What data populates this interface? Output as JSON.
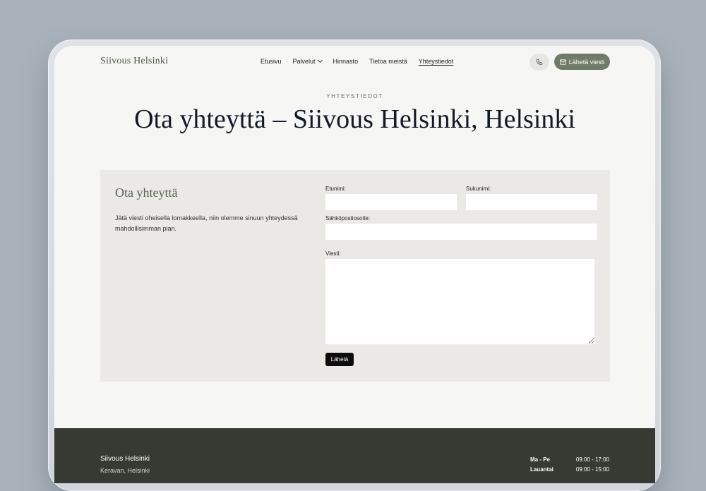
{
  "nav": {
    "brand": "Siivous Helsinki",
    "items": [
      {
        "label": "Etusivu"
      },
      {
        "label": "Palvelut"
      },
      {
        "label": "Hinnasto"
      },
      {
        "label": "Tietoa meistä"
      },
      {
        "label": "Yhteystiedot"
      }
    ],
    "cta_label": "Lähetä viesti"
  },
  "hero": {
    "eyebrow": "YHTEYSTIEDOT",
    "title": "Ota yhteyttä – Siivous Helsinki, Helsinki"
  },
  "contact": {
    "title": "Ota yhteyttä",
    "description": "Jätä viesti oheisella lomakkeella, niin olemme sinuun yhteydessä mahdollisimman pian.",
    "fields": {
      "first_name_label": "Etunimi:",
      "last_name_label": "Sukunimi:",
      "email_label": "Sähköpostiosoite:",
      "message_label": "Viesti:"
    },
    "submit_label": "Lähetä"
  },
  "footer": {
    "brand": "Siivous Helsinki",
    "sub": "Keravan, Helsinki",
    "hours": [
      {
        "day": "Ma - Pe",
        "time": "09:00 - 17:00"
      },
      {
        "day": "Lauantai",
        "time": "09:00 - 15:00"
      }
    ]
  },
  "colors": {
    "accent": "#6f7b67",
    "footer_bg": "#353a32",
    "panel_bg": "#ebe9e6"
  }
}
